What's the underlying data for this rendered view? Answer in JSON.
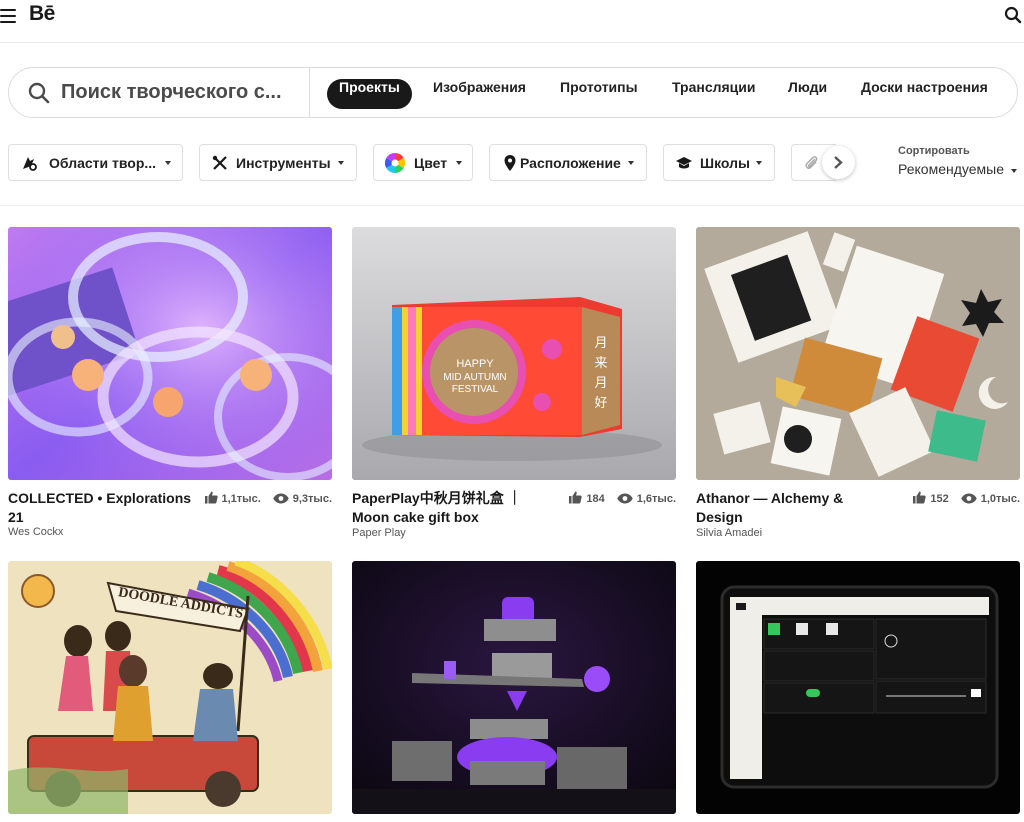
{
  "header": {
    "logo": "Bē"
  },
  "search": {
    "placeholder": "Поиск творческого с...",
    "tabs": [
      "Проекты",
      "Изображения",
      "Прототипы",
      "Трансляции",
      "Люди",
      "Доски настроения"
    ]
  },
  "filters": {
    "items": [
      {
        "label": "Области твор...",
        "icon": "creative-fields-icon"
      },
      {
        "label": "Инструменты",
        "icon": "tools-icon"
      },
      {
        "label": "Цвет",
        "icon": "color-wheel-icon"
      },
      {
        "label": "Расположение",
        "icon": "location-pin-icon"
      },
      {
        "label": "Школы",
        "icon": "graduation-cap-icon"
      }
    ],
    "sort_label": "Сортировать",
    "sort_value": "Рекомендуемые"
  },
  "projects": [
    {
      "title": "COLLECTED • Explorations 21",
      "owner": "Wes Cockx",
      "likes": "1,1тыс.",
      "views": "9,3тыс."
    },
    {
      "title": "PaperPlay中秋月饼礼盒 ｜ Moon cake gift box",
      "owner": "Paper Play",
      "likes": "184",
      "views": "1,6тыс."
    },
    {
      "title": "Athanor — Alchemy & Design",
      "owner": "Silvia Amadei",
      "likes": "152",
      "views": "1,0тыс."
    }
  ],
  "artwork": {
    "giftbox_line1": "HAPPY",
    "giftbox_line2": "MID AUTUMN",
    "giftbox_line3": "FESTIVAL",
    "giftbox_side": [
      "月",
      "来",
      "月",
      "好"
    ],
    "doodle_banner": "DOODLE ADDICTS"
  },
  "colors": {
    "accent": "#191919",
    "border": "#dcdcdc"
  }
}
